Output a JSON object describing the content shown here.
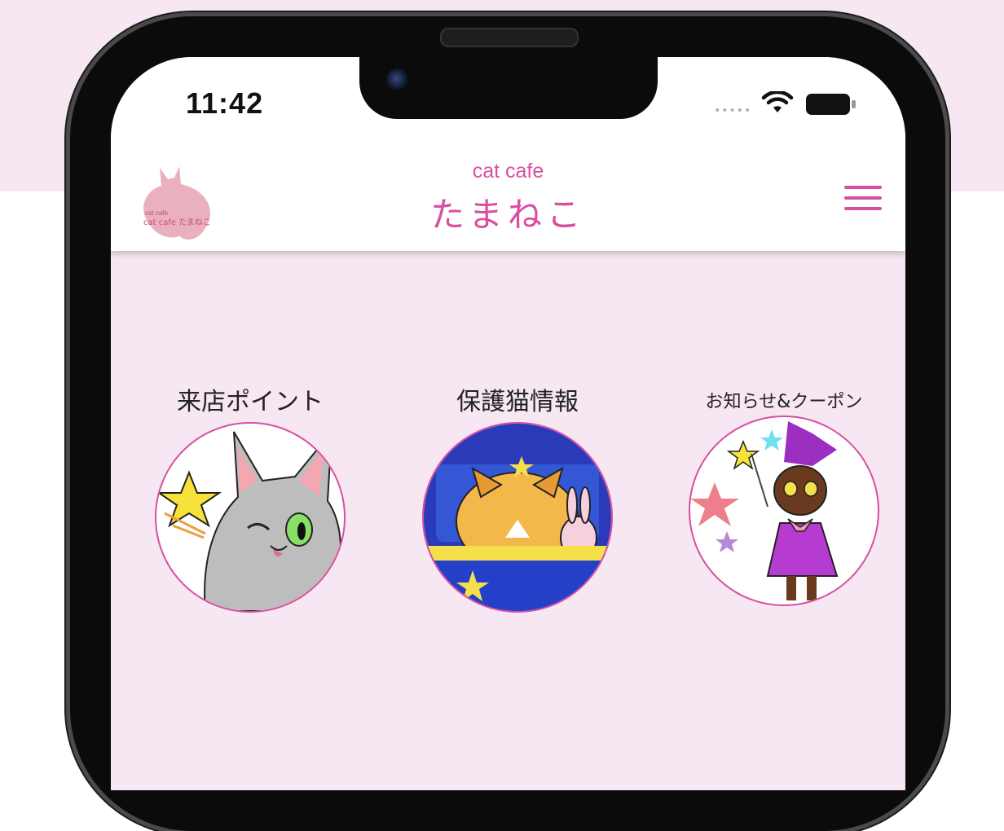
{
  "status": {
    "time": "11:42"
  },
  "header": {
    "subtitle": "cat cafe",
    "title": "たまねこ",
    "logo_text": "cat cafe たまねこ"
  },
  "menu": [
    {
      "label": "来店ポイント"
    },
    {
      "label": "保護猫情報"
    },
    {
      "label": "お知らせ&クーポン"
    }
  ],
  "colors": {
    "accent": "#d94fa0",
    "background": "#f6e7f2",
    "header": "#ffffff"
  },
  "icons": [
    "wifi-icon",
    "battery-icon",
    "hamburger-menu-icon",
    "cat-logo-icon"
  ]
}
